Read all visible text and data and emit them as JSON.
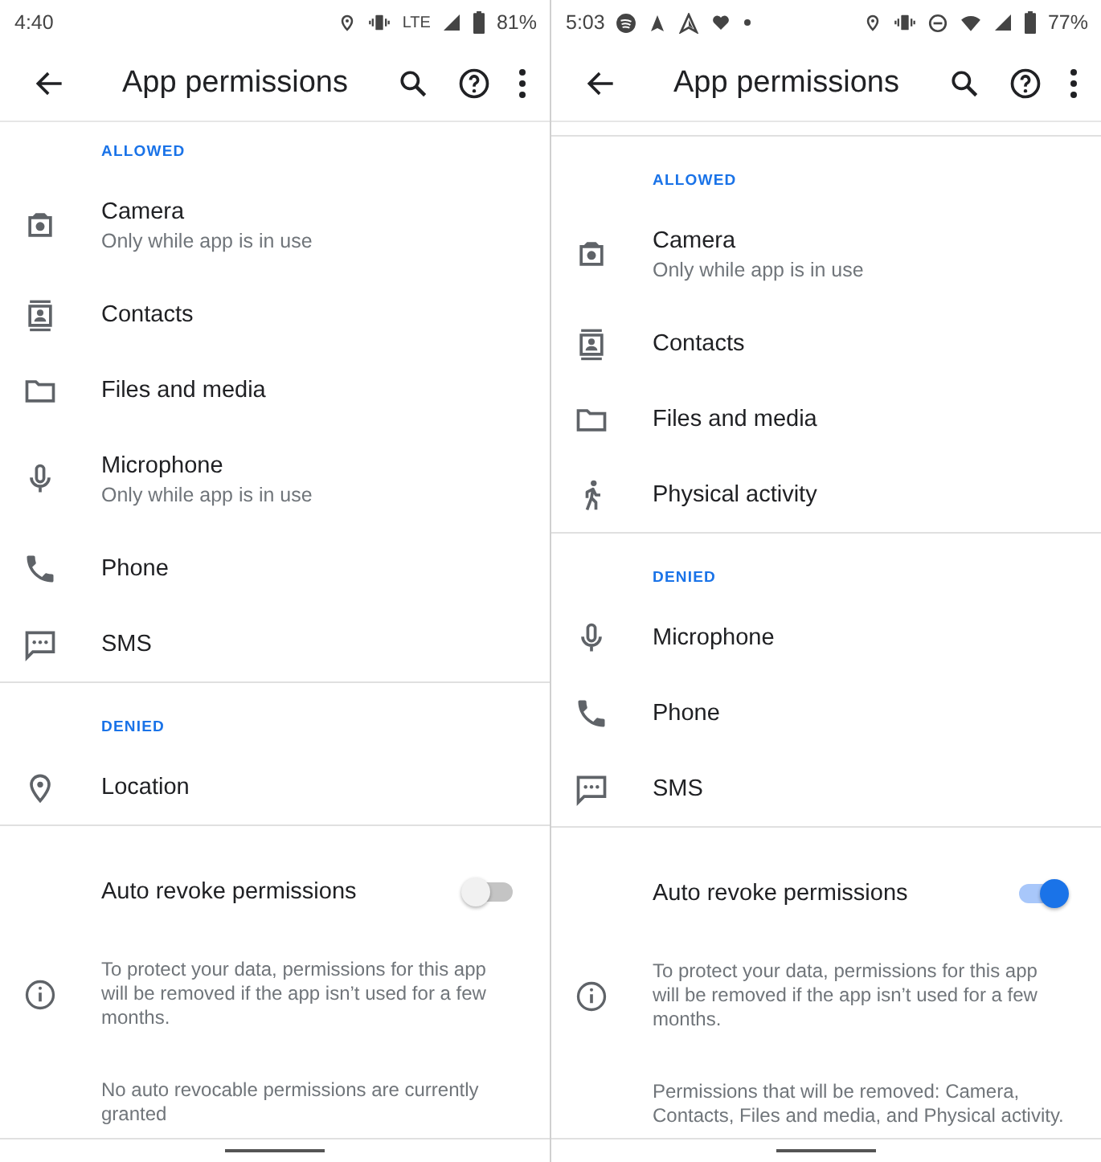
{
  "screens": [
    {
      "status_bar": {
        "time": "4:40",
        "system_icons": [
          {
            "kind": "location"
          },
          {
            "kind": "vibrate"
          },
          {
            "kind": "text",
            "text": "LTE"
          },
          {
            "kind": "signal"
          },
          {
            "kind": "battery"
          }
        ],
        "battery": "81%"
      },
      "app_bar": {
        "title": "App permissions"
      },
      "top_divider": false,
      "sections": [
        {
          "header": "ALLOWED",
          "items": [
            {
              "kind": "camera",
              "label": "Camera",
              "subtitle": "Only while app is in use"
            },
            {
              "kind": "contacts",
              "label": "Contacts"
            },
            {
              "kind": "folder",
              "label": "Files and media"
            },
            {
              "kind": "microphone",
              "label": "Microphone",
              "subtitle": "Only while app is in use"
            },
            {
              "kind": "phone",
              "label": "Phone"
            },
            {
              "kind": "sms",
              "label": "SMS"
            }
          ]
        },
        {
          "header": "DENIED",
          "items": [
            {
              "kind": "location",
              "label": "Location"
            }
          ]
        }
      ],
      "auto_revoke": {
        "label": "Auto revoke permissions",
        "on": false,
        "info": "To protect your data, permissions for this app will be removed if the app isn’t used for a few months.",
        "note": "No auto revocable permissions are currently granted"
      }
    },
    {
      "status_bar": {
        "time": "5:03",
        "notification_icons": [
          {
            "kind": "round"
          },
          {
            "kind": "navigation"
          },
          {
            "kind": "navigation-outline"
          },
          {
            "kind": "heart"
          },
          {
            "kind": "dot"
          }
        ],
        "system_icons": [
          {
            "kind": "location"
          },
          {
            "kind": "vibrate"
          },
          {
            "kind": "dnd"
          },
          {
            "kind": "wifi"
          },
          {
            "kind": "signal"
          },
          {
            "kind": "battery"
          }
        ],
        "battery": "77%"
      },
      "app_bar": {
        "title": "App permissions"
      },
      "top_divider": true,
      "sections": [
        {
          "header": "ALLOWED",
          "items": [
            {
              "kind": "camera",
              "label": "Camera",
              "subtitle": "Only while app is in use"
            },
            {
              "kind": "contacts",
              "label": "Contacts"
            },
            {
              "kind": "folder",
              "label": "Files and media"
            },
            {
              "kind": "walking",
              "label": "Physical activity"
            }
          ]
        },
        {
          "header": "DENIED",
          "items": [
            {
              "kind": "microphone",
              "label": "Microphone"
            },
            {
              "kind": "phone",
              "label": "Phone"
            },
            {
              "kind": "sms",
              "label": "SMS"
            }
          ]
        }
      ],
      "auto_revoke": {
        "label": "Auto revoke permissions",
        "on": true,
        "info": "To protect your data, permissions for this app will be removed if the app isn’t used for a few months.",
        "note": "Permissions that will be removed: Camera, Contacts, Files and media, and Physical activity."
      }
    }
  ]
}
